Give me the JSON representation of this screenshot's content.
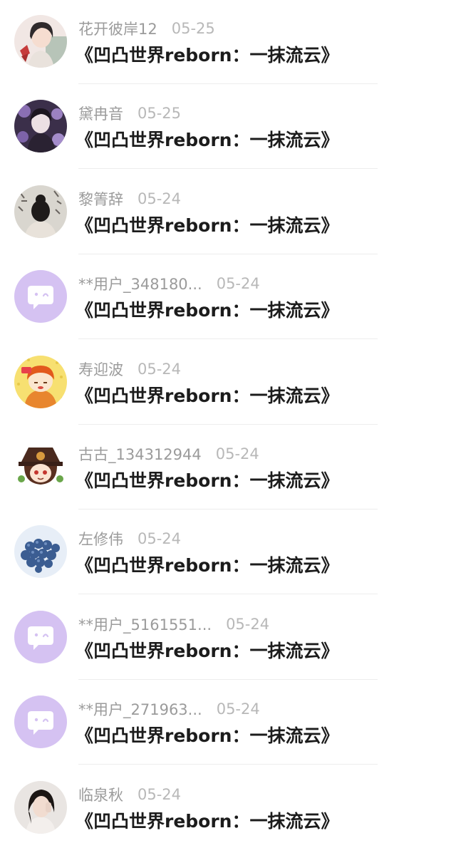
{
  "items": [
    {
      "username": "花开彼岸12",
      "date": "05-25",
      "title": "《凹凸世界reborn：一抹流云》",
      "avatar": "anime-avatar-pink"
    },
    {
      "username": "黛冉音",
      "date": "05-25",
      "title": "《凹凸世界reborn：一抹流云》",
      "avatar": "anime-avatar-purple-flowers"
    },
    {
      "username": "黎箐辞",
      "date": "05-24",
      "title": "《凹凸世界reborn：一抹流云》",
      "avatar": "photo-avatar-calligraphy"
    },
    {
      "username": "**用户_348180...",
      "date": "05-24",
      "title": "《凹凸世界reborn：一抹流云》",
      "avatar": "default-chat-bubble-avatar"
    },
    {
      "username": "寿迎波",
      "date": "05-24",
      "title": "《凹凸世界reborn：一抹流云》",
      "avatar": "cartoon-avatar-orange"
    },
    {
      "username": "古古_134312944",
      "date": "05-24",
      "title": "《凹凸世界reborn：一抹流云》",
      "avatar": "anime-avatar-hat"
    },
    {
      "username": "左修伟",
      "date": "05-24",
      "title": "《凹凸世界reborn：一抹流云》",
      "avatar": "photo-avatar-blue-grapes"
    },
    {
      "username": "**用户_5161551...",
      "date": "05-24",
      "title": "《凹凸世界reborn：一抹流云》",
      "avatar": "default-chat-bubble-avatar"
    },
    {
      "username": "**用户_271963...",
      "date": "05-24",
      "title": "《凹凸世界reborn：一抹流云》",
      "avatar": "default-chat-bubble-avatar"
    },
    {
      "username": "临泉秋",
      "date": "05-24",
      "title": "《凹凸世界reborn：一抹流云》",
      "avatar": "photo-avatar-portrait"
    }
  ],
  "colors": {
    "username": "#9b9b9b",
    "date": "#b8b8b8",
    "title": "#1c1c1c",
    "default_avatar_bg": "#d5c2f2"
  }
}
